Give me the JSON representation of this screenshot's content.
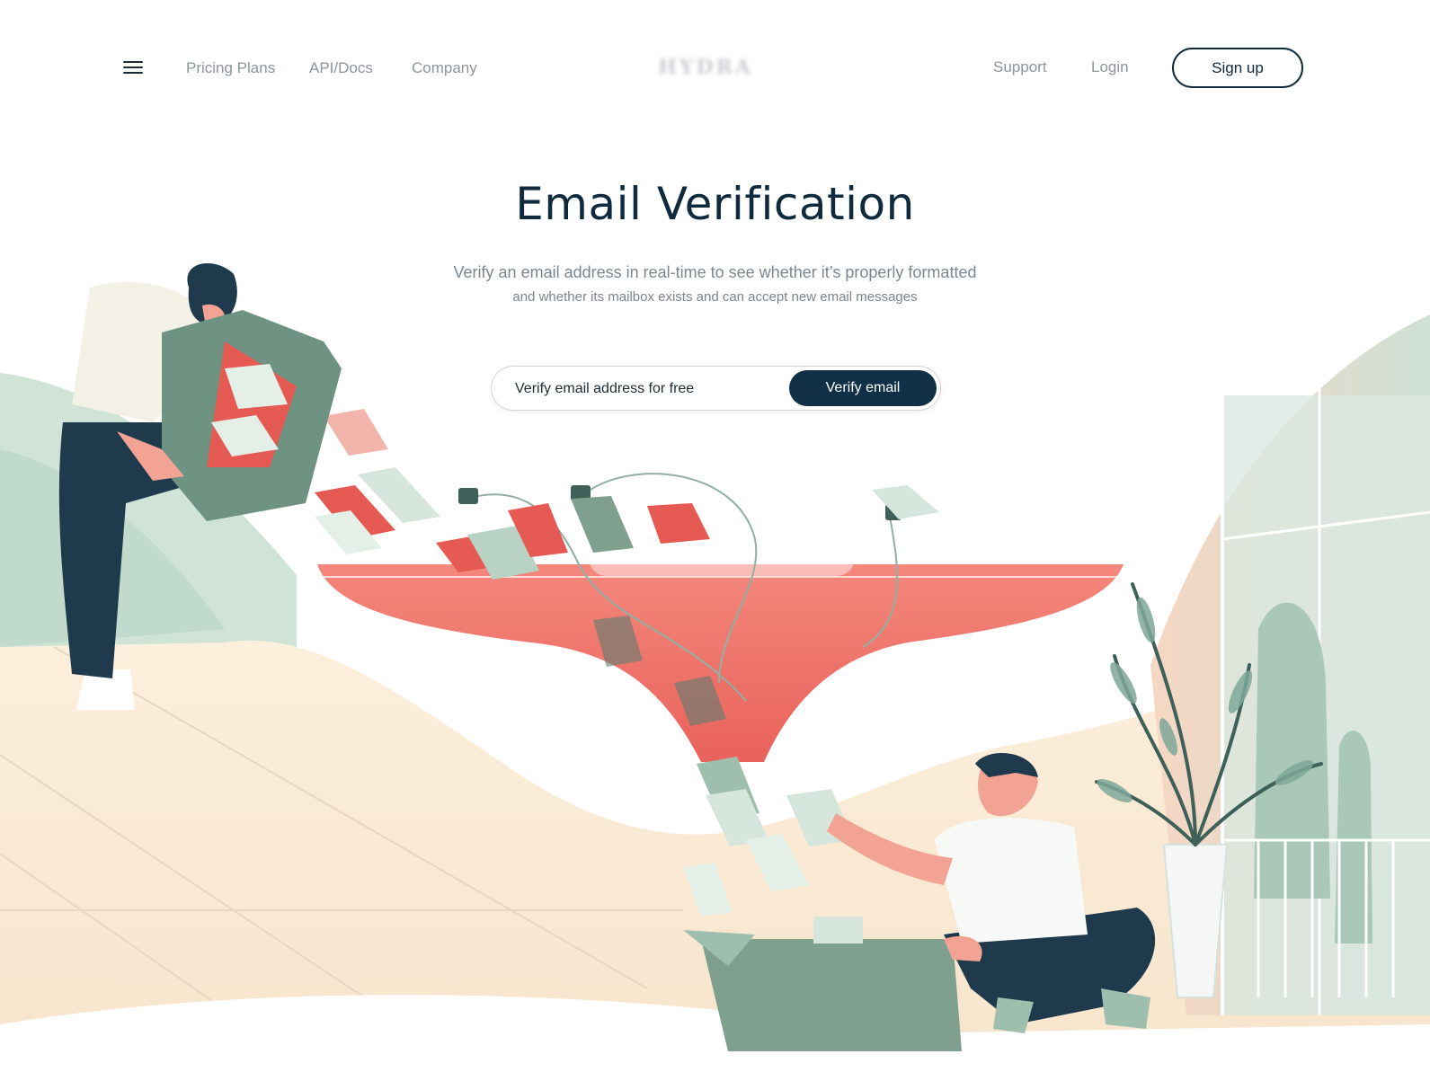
{
  "header": {
    "nav_left": [
      "Pricing Plans",
      "API/Docs",
      "Company"
    ],
    "logo_text": "HYDRA",
    "support_label": "Support",
    "login_label": "Login",
    "signup_label": "Sign up"
  },
  "hero": {
    "title": "Email Verification",
    "subtitle_line1": "Verify an email address in real-time to see whether it’s properly formatted",
    "subtitle_line2": "and whether its mailbox exists and can accept new email messages"
  },
  "verify_form": {
    "placeholder": "Verify email address for free",
    "button_label": "Verify email"
  },
  "colors": {
    "navy": "#0f2a3d",
    "coral": "#f07068",
    "sage": "#9ebfad",
    "cream": "#fbeedd",
    "muted_text": "#8c959c"
  }
}
